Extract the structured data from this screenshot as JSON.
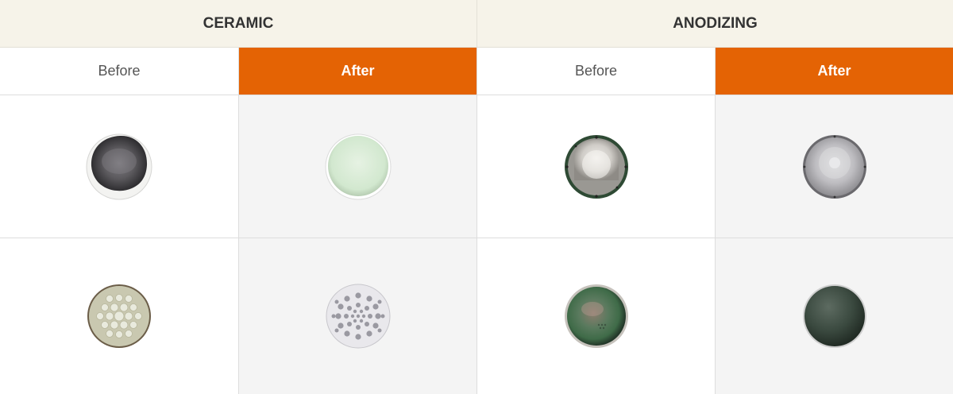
{
  "categories": [
    {
      "title": "CERAMIC"
    },
    {
      "title": "ANODIZING"
    }
  ],
  "columns": [
    {
      "label": "Before",
      "state": "before"
    },
    {
      "label": "After",
      "state": "after"
    },
    {
      "label": "Before",
      "state": "before"
    },
    {
      "label": "After",
      "state": "after"
    }
  ],
  "colors": {
    "header_bg": "#f6f3e9",
    "after_accent": "#e46304",
    "after_cell_bg": "#f4f4f4",
    "border": "#dddddd"
  },
  "samples": [
    [
      "dark-ceramic-disc",
      "pale-green-ceramic-disc",
      "metal-plate-before-anodizing",
      "metal-plate-after-anodizing"
    ],
    [
      "perforated-ceramic-disc-before",
      "perforated-ceramic-disc-after",
      "green-tinted-disc-before",
      "dark-green-anodized-disc"
    ]
  ]
}
